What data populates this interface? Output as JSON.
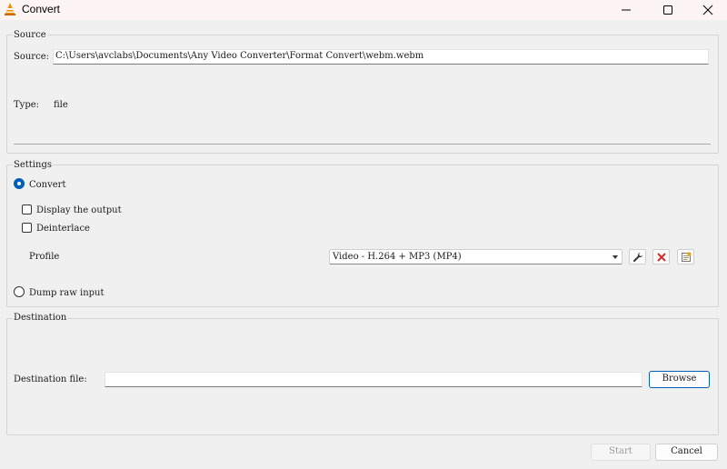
{
  "window": {
    "title": "Convert",
    "icon": "vlc-cone-icon",
    "controls": [
      "minimize-icon",
      "maximize-icon",
      "close-icon"
    ]
  },
  "source": {
    "group_title": "Source",
    "source_label": "Source:",
    "source_value": "C:\\Users\\avclabs\\Documents\\Any Video Converter\\Format Convert\\webm.webm",
    "type_label": "Type:",
    "type_value": "file"
  },
  "settings": {
    "group_title": "Settings",
    "convert_label": "Convert",
    "convert_checked": true,
    "display_output_label": "Display the output",
    "display_output_checked": false,
    "deinterlace_label": "Deinterlace",
    "deinterlace_checked": false,
    "profile_label": "Profile",
    "profile_value": "Video - H.264 + MP3 (MP4)",
    "profile_buttons": [
      "wrench-icon",
      "delete-x-icon",
      "new-profile-icon"
    ],
    "dump_raw_label": "Dump raw input",
    "dump_raw_checked": false
  },
  "destination": {
    "group_title": "Destination",
    "file_label": "Destination file:",
    "file_value": "",
    "browse_label": "Browse"
  },
  "footer": {
    "start_label": "Start",
    "start_enabled": false,
    "cancel_label": "Cancel"
  },
  "colors": {
    "accent": "#005fb8",
    "titlebar_bg": "#fdf4f4",
    "window_bg": "#f0f0f0",
    "delete_red": "#d32f2f",
    "vlc_orange": "#f08c00"
  }
}
